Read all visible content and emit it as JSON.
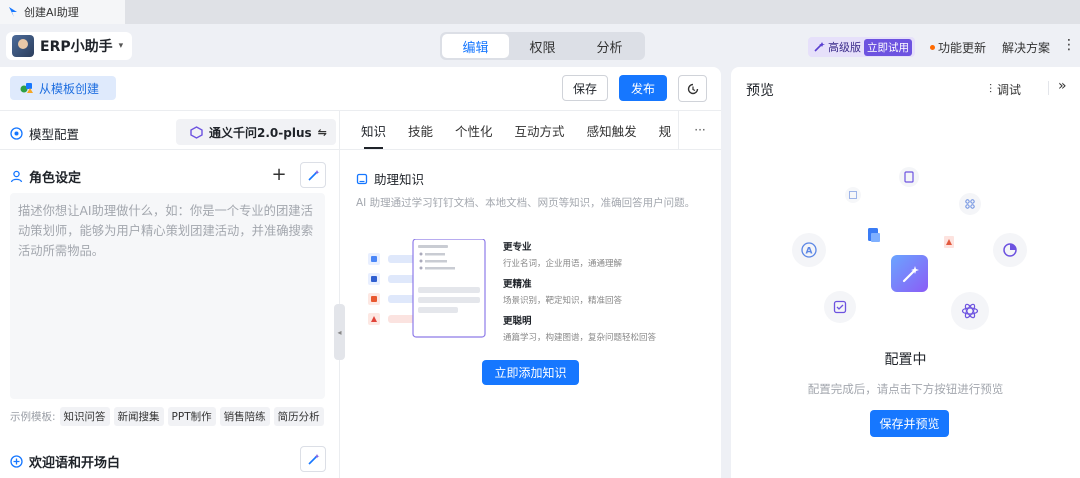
{
  "browser_tab": {
    "title": "创建AI助理"
  },
  "header": {
    "app_name": "ERP小助手",
    "modes": [
      "编辑",
      "权限",
      "分析"
    ],
    "active_mode": "编辑",
    "pro_label": "高级版",
    "pro_trial": "立即试用",
    "update_label": "功能更新",
    "solution_label": "解决方案"
  },
  "editor": {
    "template_button": "从模板创建",
    "save_button": "保存",
    "publish_button": "发布",
    "model_label": "模型配置",
    "model_value": "通义千问2.0-plus",
    "role_title": "角色设定",
    "role_placeholder": "描述你想让AI助理做什么，如：你是一个专业的团建活动策划师，能够为用户精心策划团建活动，并准确搜索活动所需物品。",
    "examples_label": "示例模板:",
    "examples": [
      "知识问答",
      "新闻搜集",
      "PPT制作",
      "销售陪练",
      "简历分析"
    ],
    "welcome_title": "欢迎语和开场白",
    "tabs": [
      "知识",
      "技能",
      "个性化",
      "互动方式",
      "感知触发",
      "规"
    ],
    "tabs_more": "···",
    "knowledge_title": "助理知识",
    "knowledge_desc": "AI 助理通过学习钉钉文档、本地文档、网页等知识，准确回答用户问题。",
    "features": [
      {
        "title": "更专业",
        "desc": "行业名词，企业用语，通通理解"
      },
      {
        "title": "更精准",
        "desc": "场景识别，靶定知识，精准回答"
      },
      {
        "title": "更聪明",
        "desc": "通篇学习，构建图谱，复杂问题轻松回答"
      }
    ],
    "add_knowledge_button": "立即添加知识"
  },
  "preview": {
    "title": "预览",
    "debug_label": "调试",
    "status": "配置中",
    "hint": "配置完成后，请点击下方按钮进行预览",
    "button": "保存并预览"
  },
  "colors": {
    "primary": "#1677ff",
    "accent_purple": "#6d53e0",
    "orange_dot": "#ff6a00"
  }
}
